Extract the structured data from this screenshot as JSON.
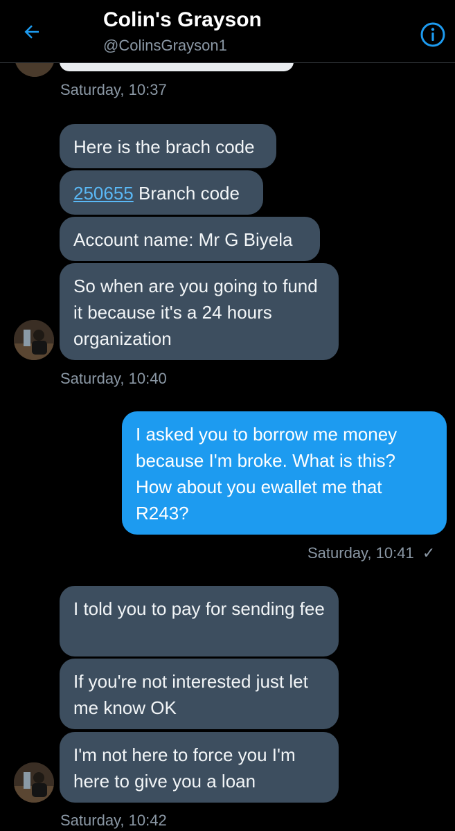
{
  "header": {
    "title": "Colin's Grayson",
    "handle": "@ColinsGrayson1"
  },
  "messages": [
    {
      "type": "received",
      "text": "Here is the brach code"
    },
    {
      "type": "received",
      "link": "250655",
      "text": " Branch code"
    },
    {
      "type": "received",
      "text": "Account name: Mr  G Biyela"
    },
    {
      "type": "received",
      "text": "So when are you going to fund it because it's a 24 hours organization"
    },
    {
      "type": "sent",
      "text": "I asked you to borrow me money because I'm broke. What is this? How about you ewallet me that R243?"
    },
    {
      "type": "received",
      "text": "I told you to pay for sending fee"
    },
    {
      "type": "received",
      "text": "If you're not interested just let me know OK"
    },
    {
      "type": "received",
      "text": "I'm not here to force you I'm here to give you a loan"
    }
  ],
  "timestamps": [
    "Saturday, 10:37",
    "Saturday, 10:40",
    "Saturday, 10:41",
    "Saturday, 10:42"
  ],
  "read_check": "✓",
  "colors": {
    "background": "#000000",
    "received_bubble": "#3d4e5f",
    "sent_bubble": "#1d9bf0",
    "accent": "#1d9bf0",
    "muted_text": "#8b98a5"
  },
  "icons": {
    "back": "back-arrow-icon",
    "info": "info-icon"
  }
}
